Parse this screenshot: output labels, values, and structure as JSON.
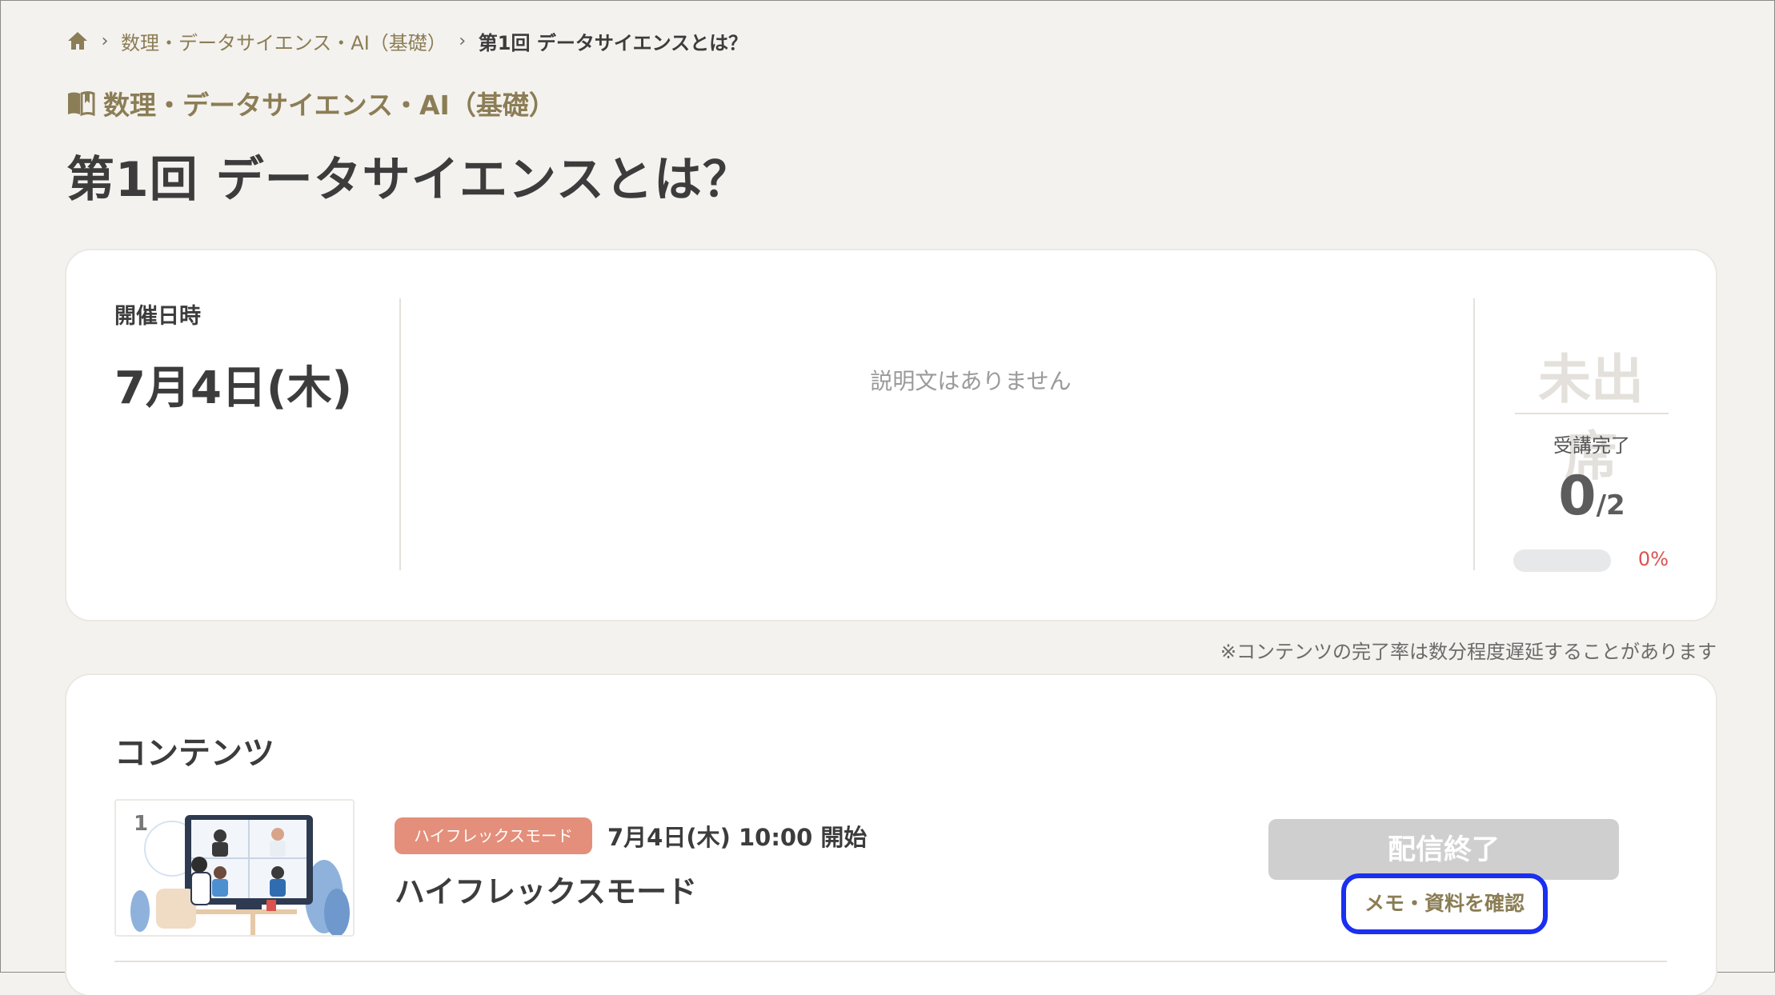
{
  "breadcrumb": {
    "home_icon": "home-icon",
    "course_link": "数理・データサイエンス・AI（基礎）",
    "current": "第1回 データサイエンスとは？"
  },
  "course": {
    "icon": "book-icon",
    "name": "数理・データサイエンス・AI（基礎）"
  },
  "page_title": "第1回 データサイエンスとは？",
  "summary": {
    "date_label": "開催日時",
    "date_value": "7月4日(木)",
    "description": "説明文はありません",
    "attendance_status": "未出席",
    "completion_label": "受講完了",
    "completed_count": "0",
    "total_count": "/2",
    "progress_fraction": 0,
    "progress_percent_text": "0%",
    "colors": {
      "progress": "#d9534f",
      "track": "#e6e8ea"
    }
  },
  "note": "※コンテンツの完了率は数分程度遅延することがあります",
  "contents": {
    "heading": "コンテンツ",
    "items": [
      {
        "number": "1",
        "mode_badge": "ハイフレックスモード",
        "start_time": "7月4日(木) 10:00 開始",
        "title": "ハイフレックスモード",
        "status_button": "配信終了",
        "memo_link": "メモ・資料を確認"
      }
    ]
  }
}
